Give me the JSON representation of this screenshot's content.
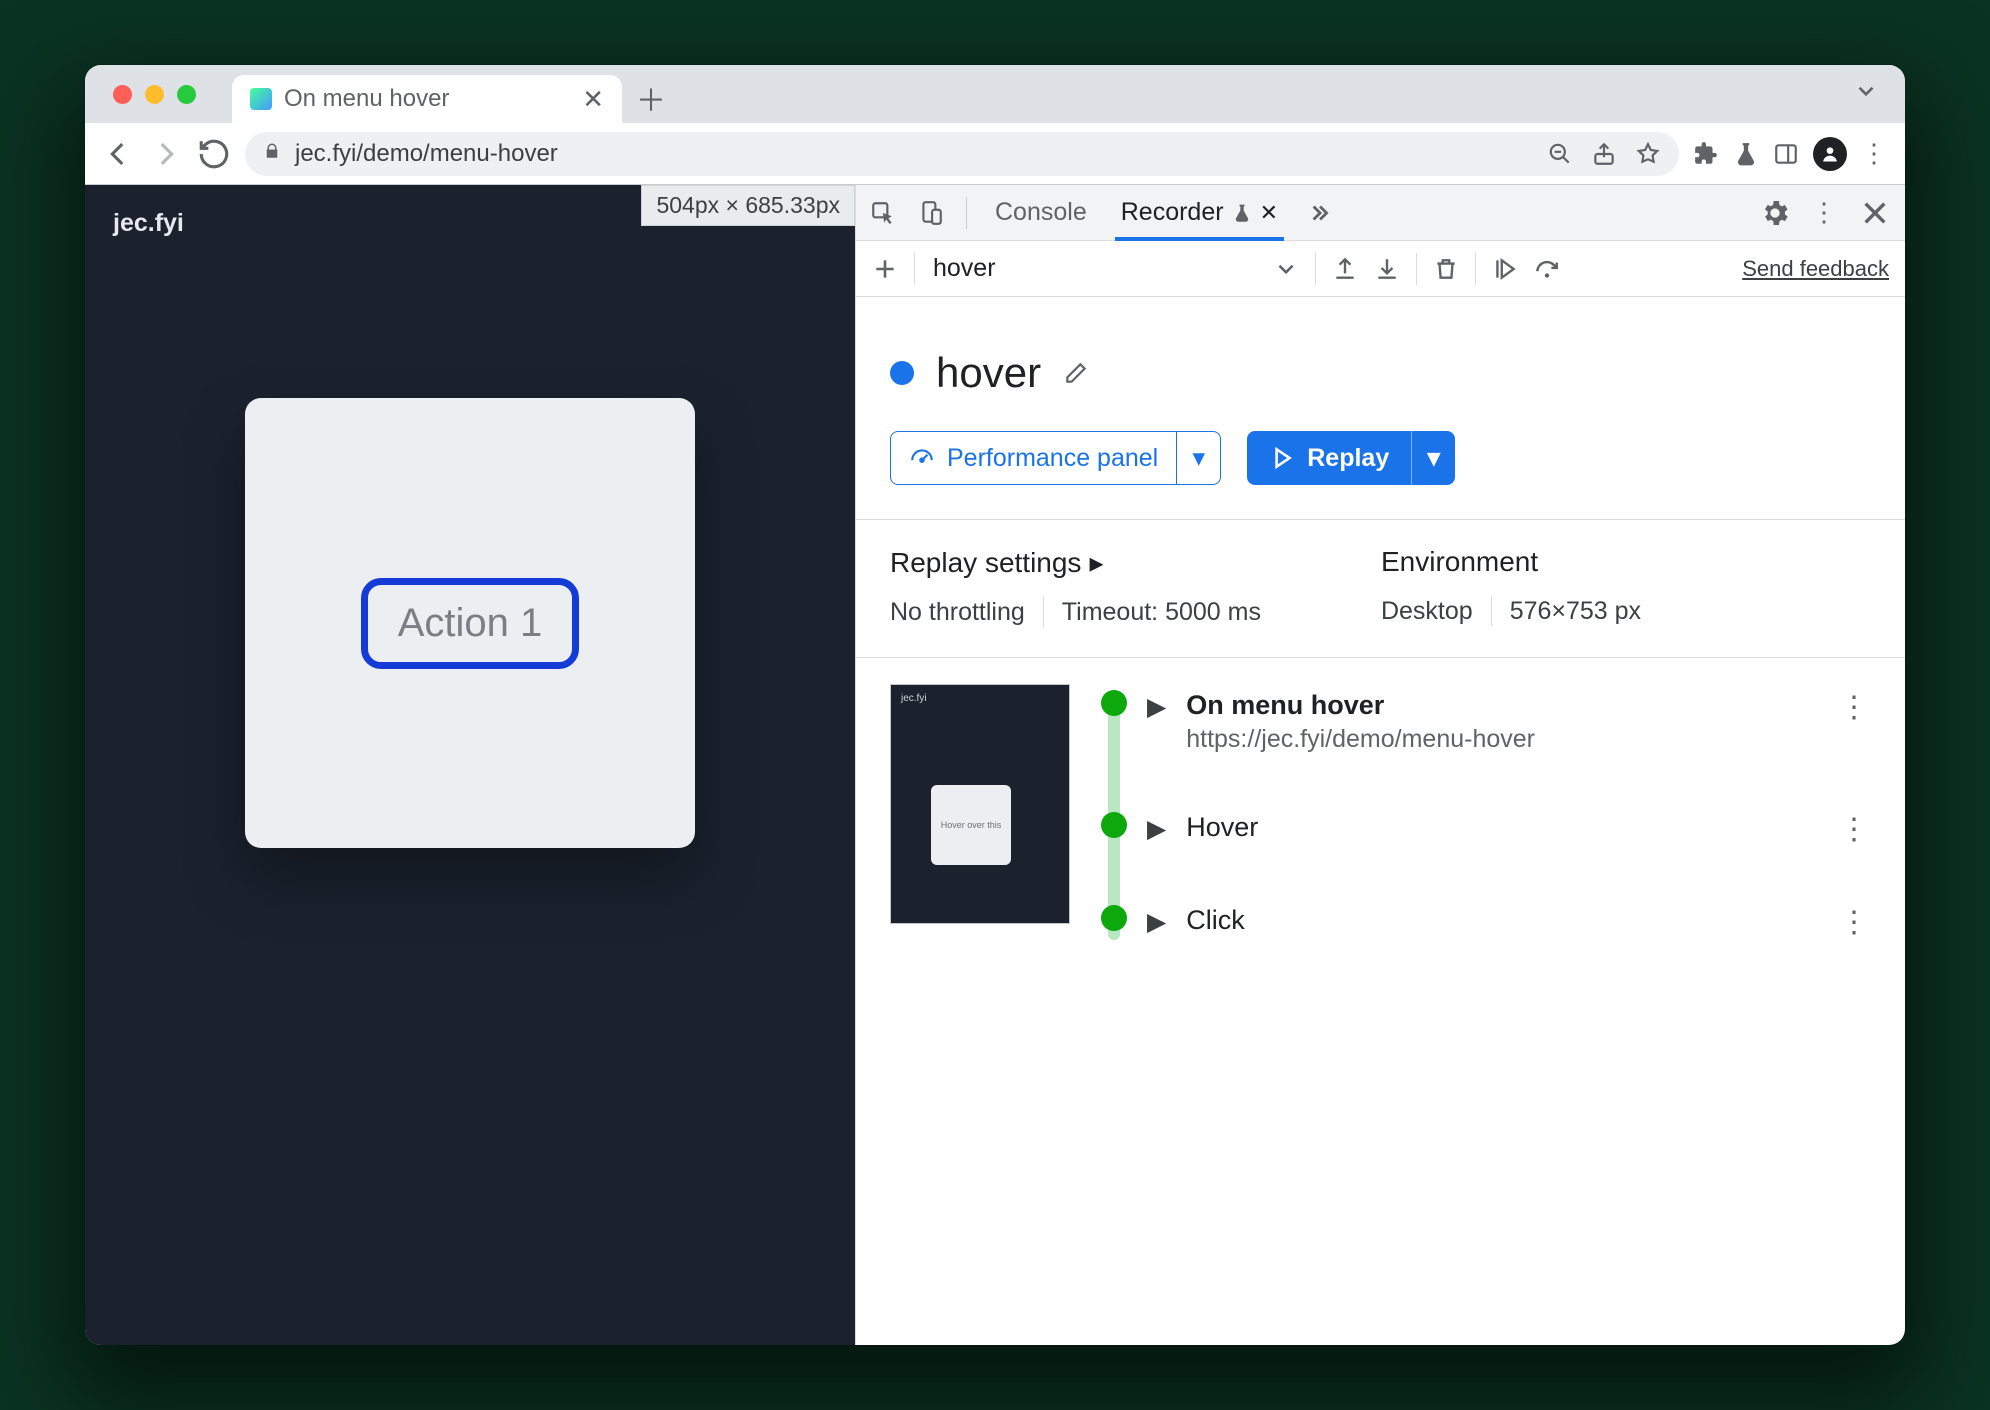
{
  "browser": {
    "tab_title": "On menu hover",
    "url_display": "jec.fyi/demo/menu-hover"
  },
  "page": {
    "site_label": "jec.fyi",
    "dimension_overlay": "504px × 685.33px",
    "action_button": "Action 1"
  },
  "devtools": {
    "tabs": {
      "console": "Console",
      "recorder": "Recorder"
    },
    "subbar": {
      "recording_name": "hover",
      "feedback": "Send feedback"
    },
    "recording": {
      "title": "hover",
      "perf_btn": "Performance panel",
      "replay_btn": "Replay"
    },
    "settings": {
      "replay_heading": "Replay settings",
      "throttling": "No throttling",
      "timeout": "Timeout: 5000 ms",
      "env_heading": "Environment",
      "device": "Desktop",
      "viewport": "576×753 px"
    },
    "thumb_mini": "Hover over this",
    "steps": [
      {
        "title": "On menu hover",
        "subtitle": "https://jec.fyi/demo/menu-hover"
      },
      {
        "title": "Hover"
      },
      {
        "title": "Click"
      }
    ]
  }
}
